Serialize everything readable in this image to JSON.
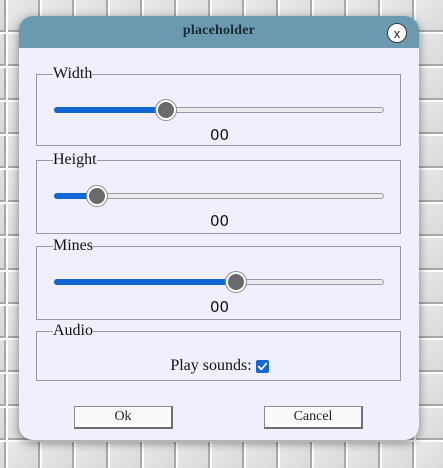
{
  "dialog": {
    "title": "placeholder",
    "close_label": "x"
  },
  "width": {
    "legend": "Width",
    "value": "00",
    "level": 0.34
  },
  "height": {
    "legend": "Height",
    "value": "00",
    "level": 0.13
  },
  "mines": {
    "legend": "Mines",
    "value": "00",
    "level": 0.55
  },
  "audio": {
    "legend": "Audio",
    "play_sounds_label": "Play sounds:",
    "play_sounds_checked": true
  },
  "buttons": {
    "ok_label": "Ok",
    "cancel_label": "Cancel"
  },
  "colors": {
    "titlebar": "#6b9ab0",
    "dialog_background": "#f0effd",
    "accent": "#1167d6",
    "slider_thumb": "#6a6a6a"
  }
}
